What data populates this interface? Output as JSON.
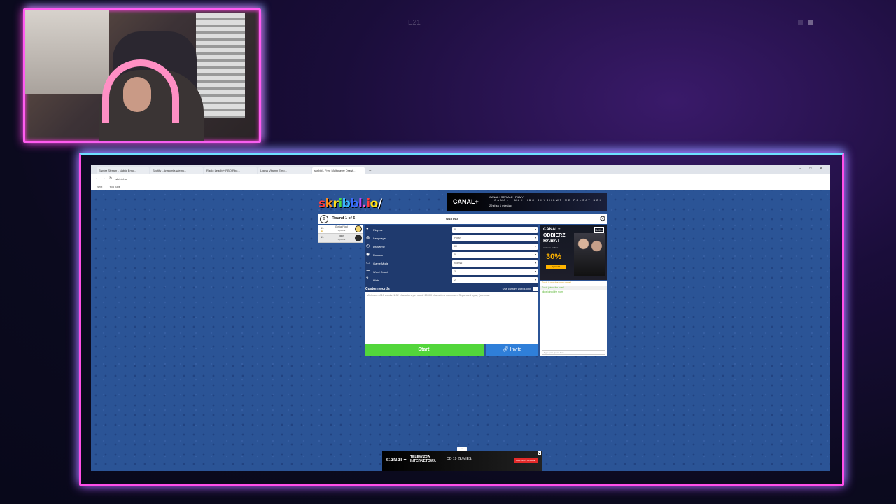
{
  "overlay": {
    "top_label": "E21"
  },
  "browser": {
    "tabs": [
      {
        "label": "Stwórz Stream - Nabór Emo..."
      },
      {
        "label": "Spotify - Anatomia wierny..."
      },
      {
        "label": "Radio Leadb + RBO Rbo..."
      },
      {
        "label": "Ligma Vitamin Emo..."
      },
      {
        "label": "skribbl - Free Multiplayer Drawi..."
      }
    ],
    "url": "skribbl.io",
    "bookmarks": [
      {
        "label": "Next"
      },
      {
        "label": "YouTube"
      }
    ]
  },
  "game": {
    "logo": "skribbl.io",
    "round_label": "Round 1 of 5",
    "status": "WAITING",
    "players": [
      {
        "rank": "#1",
        "name": "Gosia (You)",
        "points": "0 points"
      },
      {
        "rank": "#1",
        "name": "nikos",
        "points": "0 points"
      }
    ],
    "settings": [
      {
        "label": "Players",
        "value": "8",
        "icon": "person-icon"
      },
      {
        "label": "Language",
        "value": "Polish",
        "icon": "language-icon"
      },
      {
        "label": "Drawtime",
        "value": "80",
        "icon": "clock-icon"
      },
      {
        "label": "Rounds",
        "value": "5",
        "icon": "rounds-icon"
      },
      {
        "label": "Game Mode",
        "value": "Normal",
        "icon": "game-mode-icon"
      },
      {
        "label": "Word Count",
        "value": "3",
        "icon": "word-count-icon"
      },
      {
        "label": "Hints",
        "value": "2",
        "icon": "hints-icon"
      }
    ],
    "custom_words": {
      "label": "Custom words",
      "use_only_label": "Use custom words only",
      "placeholder": "Minimum of 10 words. 1-32 characters per word! 20000 characters maximum. Separated by a , (comma)"
    },
    "start_label": "Start!",
    "invite_label": "Invite"
  },
  "chat": {
    "messages": [
      {
        "text": "Gosia is now the room owner!",
        "color": "#d8a21c"
      },
      {
        "text": "Gosia joined the room!",
        "color": "#5fb83a"
      },
      {
        "text": "nikos joined the room!",
        "color": "#5fb83a"
      }
    ],
    "placeholder": "Type your guess here..."
  },
  "ads": {
    "top": {
      "brand": "CANAL+",
      "line1": "CANAL+ SERIALE I FILMY",
      "line2": "29 zł za 1 miesiąc",
      "partners": "CANAL+ MAX  HBO  SKYSHOWTIME  POLSAT BOX"
    },
    "side": {
      "brand": "CANAL+",
      "headline": "ODBIERZ RABAT",
      "sub": "w ofercie CANAL+",
      "percent": "30%",
      "cta": "Sprawdź",
      "logo": "Belfer"
    },
    "bottom": {
      "brand": "CANAL+",
      "product": "TELEWIZJA INTERNETOWA",
      "price": "OD 19 ZŁ/MIES.",
      "cta": "SPRAWDŹ OFERTĘ"
    }
  },
  "colors": {
    "neon_pink": "#ff4fe8",
    "neon_cyan": "#6de0ff",
    "game_bg": "#2b5496",
    "start_green": "#52d63b",
    "invite_blue": "#2f7fd9"
  }
}
